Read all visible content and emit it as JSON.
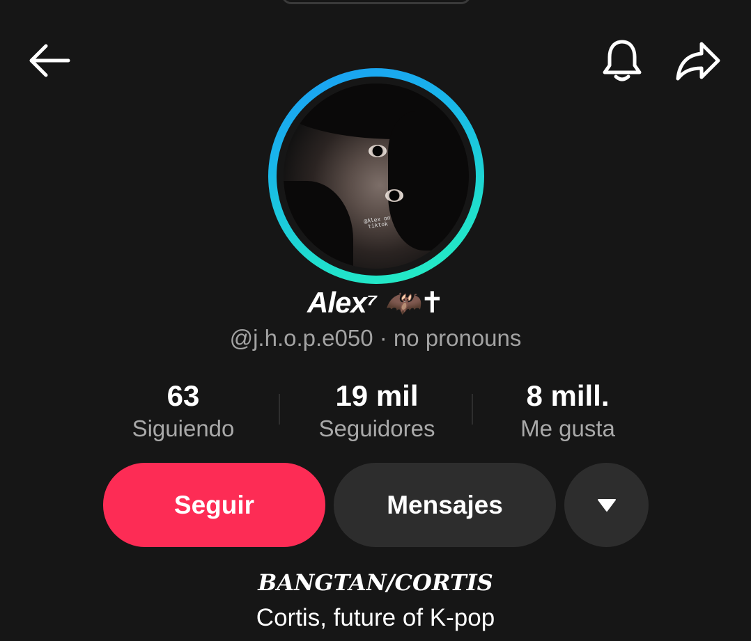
{
  "header": {
    "back_icon": "arrow-left-icon",
    "bell_icon": "bell-icon",
    "share_icon": "share-arrow-icon"
  },
  "profile": {
    "display_name": "Alex⁷ 🦇✝",
    "handle_line": "@j.h.o.p.e050 · no pronouns",
    "avatar_watermark": "@Alex on tiktok",
    "ring_colors": [
      "#1a9cf5",
      "#26f0c1"
    ]
  },
  "stats": [
    {
      "value": "63",
      "label": "Siguiendo"
    },
    {
      "value": "19 mil",
      "label": "Seguidores"
    },
    {
      "value": "8 mill.",
      "label": "Me gusta"
    }
  ],
  "actions": {
    "follow_label": "Seguir",
    "message_label": "Mensajes",
    "more_icon": "caret-down-icon",
    "follow_color": "#fd2c55"
  },
  "bio": {
    "title": "BANGTAN/CORTIS",
    "line1": "Cortis, future of K-pop"
  }
}
